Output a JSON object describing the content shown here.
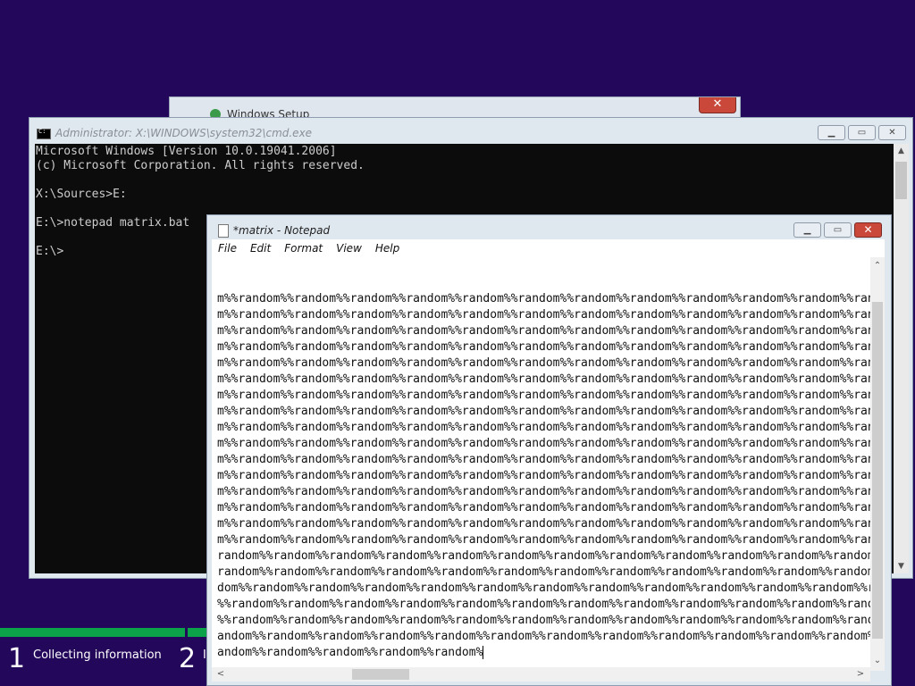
{
  "setup_window": {
    "title": "Windows Setup",
    "close_glyph": "✕"
  },
  "cmd_window": {
    "title": "Administrator: X:\\WINDOWS\\system32\\cmd.exe",
    "buttons": {
      "minimize": "▁",
      "maximize": "▭",
      "close": "✕"
    },
    "lines": [
      "Microsoft Windows [Version 10.0.19041.2006]",
      "(c) Microsoft Corporation. All rights reserved.",
      "",
      "X:\\Sources>E:",
      "",
      "E:\\>notepad matrix.bat",
      "",
      "E:\\>"
    ]
  },
  "notepad_window": {
    "title": "*matrix - Notepad",
    "buttons": {
      "minimize": "▁",
      "maximize": "▭",
      "close": "✕"
    },
    "menu": [
      "File",
      "Edit",
      "Format",
      "View",
      "Help"
    ],
    "lines": [
      "m%%random%%random%%random%%random%%random%%random%%random%%random%%random%%random%%random%%random%",
      "m%%random%%random%%random%%random%%random%%random%%random%%random%%random%%random%%random%%random%",
      "m%%random%%random%%random%%random%%random%%random%%random%%random%%random%%random%%random%%random%",
      "m%%random%%random%%random%%random%%random%%random%%random%%random%%random%%random%%random%%random%",
      "m%%random%%random%%random%%random%%random%%random%%random%%random%%random%%random%%random%%random%",
      "m%%random%%random%%random%%random%%random%%random%%random%%random%%random%%random%%random%%random%",
      "m%%random%%random%%random%%random%%random%%random%%random%%random%%random%%random%%random%%random%",
      "m%%random%%random%%random%%random%%random%%random%%random%%random%%random%%random%%random%%random%",
      "m%%random%%random%%random%%random%%random%%random%%random%%random%%random%%random%%random%%random%",
      "m%%random%%random%%random%%random%%random%%random%%random%%random%%random%%random%%random%%random%",
      "m%%random%%random%%random%%random%%random%%random%%random%%random%%random%%random%%random%%random%",
      "m%%random%%random%%random%%random%%random%%random%%random%%random%%random%%random%%random%%random%",
      "m%%random%%random%%random%%random%%random%%random%%random%%random%%random%%random%%random%%random%",
      "m%%random%%random%%random%%random%%random%%random%%random%%random%%random%%random%%random%%random%",
      "m%%random%%random%%random%%random%%random%%random%%random%%random%%random%%random%%random%%random%",
      "m%%random%%random%%random%%random%%random%%random%%random%%random%%random%%random%%random%%random%",
      "random%%random%%random%%random%%random%%random%%random%%random%%random%%random%%random%%random%%ran",
      "random%%random%%random%%random%%random%%random%%random%%random%%random%%random%%random%%random%%ran",
      "dom%%random%%random%%random%%random%%random%%random%%random%%random%%random%%random%%random%%random",
      "%%random%%random%%random%%random%%random%%random%%random%%random%%random%%random%%random%%random%%r",
      "%%random%%random%%random%%random%%random%%random%%random%%random%%random%%random%%random%%random%%r",
      "andom%%random%%random%%random%%random%%random%%random%%random%%random%%random%%random%%random%%ra",
      "andom%%random%%random%%random%%random%"
    ],
    "scroll_up": "⌃",
    "scroll_down": "⌄",
    "scroll_left": "<",
    "scroll_right": ">"
  },
  "setup_progress": {
    "step1_number": "1",
    "step1_label": "Collecting information",
    "step2_number": "2",
    "step2_label": "I",
    "accent": "#0ba24a"
  }
}
